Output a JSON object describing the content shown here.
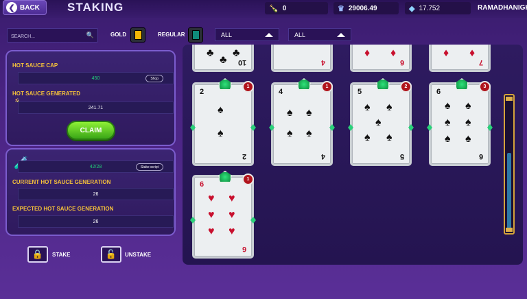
{
  "header": {
    "back_label": "BACK",
    "title": "STAKING",
    "stats": [
      {
        "icon": "sauce-bottle-icon",
        "value": "0"
      },
      {
        "icon": "crowns-icon",
        "value": "29006.49"
      },
      {
        "icon": "ticket-icon",
        "value": "17.752"
      }
    ],
    "username": "RAMADHANIGH"
  },
  "filters": {
    "search_placeholder": "SEARCH...",
    "gold_label": "GOLD",
    "regular_label": "REGULAR",
    "dropdown1": "ALL",
    "dropdown2": "ALL",
    "gold_color": "#f2b705",
    "regular_color": "#0f8a7a"
  },
  "left_panel": {
    "cap_label": "HOT SAUCE CAP",
    "cap_value": "450",
    "shop_label": "Shop",
    "generated_label": "HOT SAUCE GENERATED",
    "generated_value": "241.71",
    "claim_label": "CLAIM",
    "staked_value": "42/28",
    "stake_script_label": "Stake script",
    "current_label": "CURRENT HOT SAUCE GENERATION",
    "current_value": "26",
    "expected_label": "EXPECTED HOT SAUCE GENERATION",
    "expected_value": "26",
    "stake_label": "STAKE",
    "unstake_label": "UNSTAKE"
  },
  "cards_top_row": [
    {
      "rank": "10",
      "suit": "♣",
      "color": "black"
    },
    {
      "rank": "4",
      "suit": "♦",
      "color": "red"
    },
    {
      "rank": "6",
      "suit": "♦",
      "color": "red"
    },
    {
      "rank": "7",
      "suit": "♦",
      "color": "red"
    }
  ],
  "cards": [
    {
      "rank": "2",
      "suit": "♠",
      "color": "black",
      "count": "1"
    },
    {
      "rank": "4",
      "suit": "♠",
      "color": "black",
      "count": "1"
    },
    {
      "rank": "5",
      "suit": "♠",
      "color": "black",
      "count": "2"
    },
    {
      "rank": "6",
      "suit": "♠",
      "color": "black",
      "count": "3"
    },
    {
      "rank": "6",
      "suit": "♥",
      "color": "red",
      "count": "1"
    }
  ],
  "colors": {
    "accent_yellow": "#f6c23a",
    "claim_green": "#3aa617",
    "badge_red": "#b0141c"
  }
}
